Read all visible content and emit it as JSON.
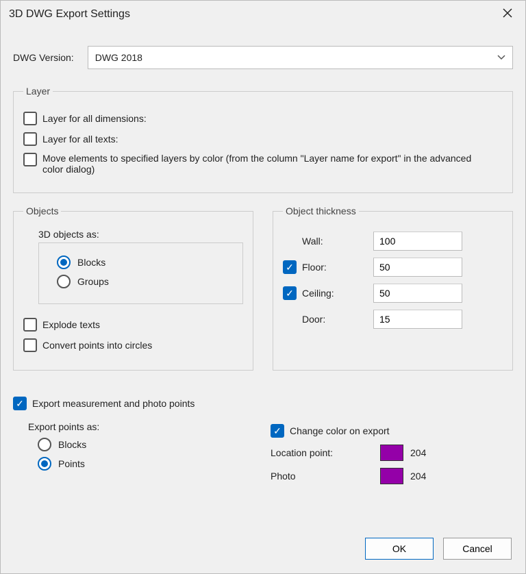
{
  "window": {
    "title": "3D DWG Export Settings"
  },
  "version": {
    "label": "DWG Version:",
    "selected": "DWG 2018"
  },
  "layer": {
    "legend": "Layer",
    "all_dimensions": {
      "label": "Layer for all dimensions:",
      "checked": false
    },
    "all_texts": {
      "label": "Layer for all texts:",
      "checked": false
    },
    "move_by_color": {
      "label": "Move elements to specified layers by color (from the column \"Layer name for export\" in the advanced color dialog)",
      "checked": false
    }
  },
  "objects": {
    "legend": "Objects",
    "group_label": "3D objects as:",
    "radio": {
      "blocks": "Blocks",
      "groups": "Groups",
      "selected": "blocks"
    },
    "explode_texts": {
      "label": "Explode texts",
      "checked": false
    },
    "convert_points": {
      "label": "Convert points into circles",
      "checked": false
    }
  },
  "thickness": {
    "legend": "Object thickness",
    "wall": {
      "label": "Wall:",
      "checked": null,
      "value": "100"
    },
    "floor": {
      "label": "Floor:",
      "checked": true,
      "value": "50"
    },
    "ceiling": {
      "label": "Ceiling:",
      "checked": true,
      "value": "50"
    },
    "door": {
      "label": "Door:",
      "checked": null,
      "value": "15"
    }
  },
  "points": {
    "export_points": {
      "label": "Export measurement and photo points",
      "checked": true
    },
    "as_label": "Export points as:",
    "radio": {
      "blocks": "Blocks",
      "points": "Points",
      "selected": "points"
    },
    "change_color": {
      "label": "Change color on export",
      "checked": true
    },
    "location": {
      "label": "Location point:",
      "color": "#9400a8",
      "value": "204"
    },
    "photo": {
      "label": "Photo",
      "color": "#9400a8",
      "value": "204"
    }
  },
  "buttons": {
    "ok": "OK",
    "cancel": "Cancel"
  }
}
